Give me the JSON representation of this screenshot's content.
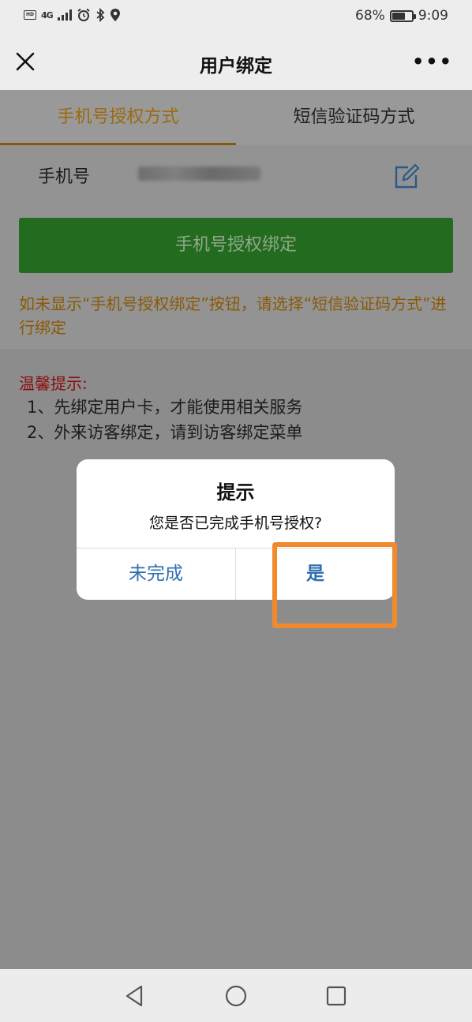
{
  "status_bar": {
    "left_badge": "HD",
    "network": "4G",
    "battery_percent": "68%",
    "battery_level": 0.68,
    "time": "9:09"
  },
  "nav": {
    "title": "用户绑定",
    "more": "•••",
    "icons": {
      "close": "close-icon",
      "more": "more-icon"
    }
  },
  "tabs": [
    {
      "label": "手机号授权方式",
      "active": true
    },
    {
      "label": "短信验证码方式",
      "active": false
    }
  ],
  "phone_row": {
    "label": "手机号",
    "edit_icon": "edit-icon"
  },
  "bind_button": {
    "label": "手机号授权绑定"
  },
  "bind_hint": "如未显示“手机号授权绑定”按钮，请选择“短信验证码方式”进行绑定",
  "tips": {
    "title": "温馨提示:",
    "lines": [
      "1、先绑定用户卡，才能使用相关服务",
      "2、外来访客绑定，请到访客绑定菜单"
    ]
  },
  "dialog": {
    "title": "提示",
    "message": "您是否已完成手机号授权?",
    "cancel_label": "未完成",
    "confirm_label": "是"
  },
  "system_nav": {
    "back": "back-triangle-icon",
    "home": "home-circle-icon",
    "recents": "recents-square-icon"
  },
  "colors": {
    "accent_tab": "#9b6a10",
    "bind_button": "#236b1e",
    "tips_title": "#8a0d0d",
    "dialog_button": "#2f6fb0",
    "highlight": "#f08a2d"
  }
}
